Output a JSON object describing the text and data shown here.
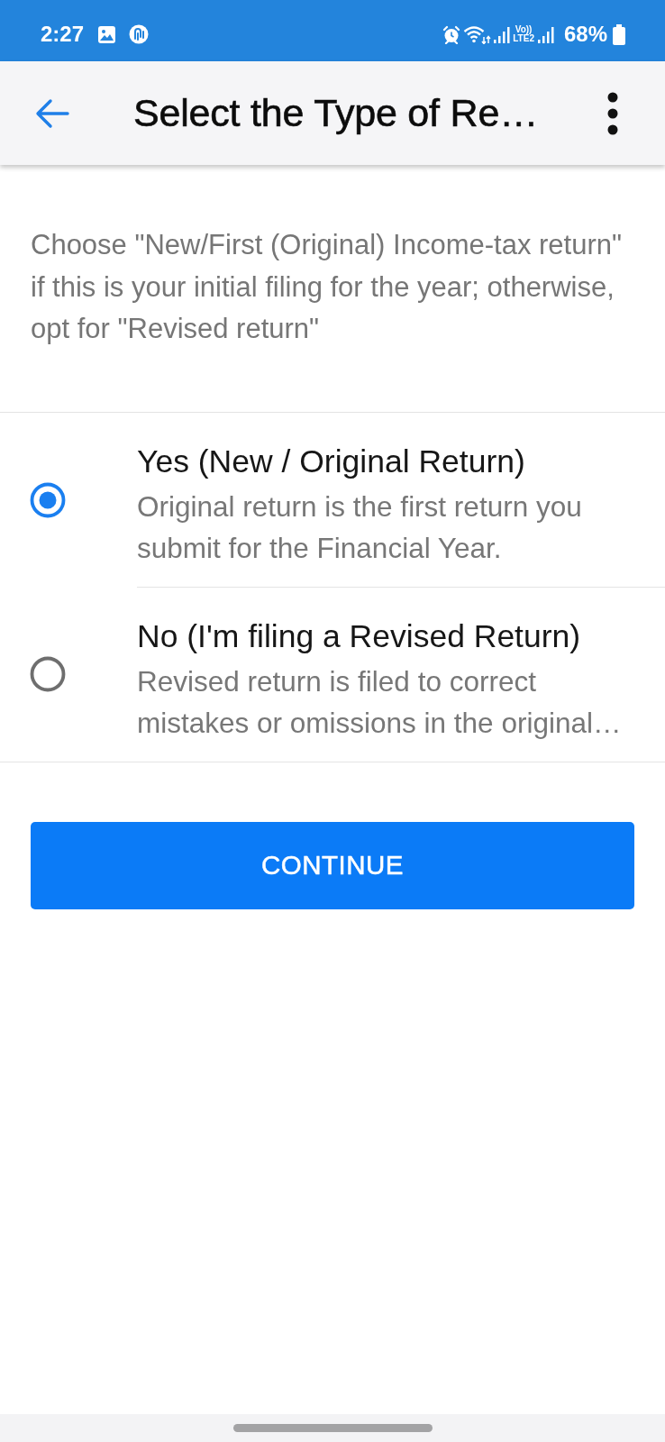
{
  "status_bar": {
    "time": "2:27",
    "network_top": "Vo))",
    "network_bottom": "LTE2",
    "battery": "68%"
  },
  "app_bar": {
    "title": "Select the Type of Re…"
  },
  "description": "Choose \"New/First (Original) Income-tax return\" if this is your initial filing for the year; otherwise, opt for \"Revised return\"",
  "options": [
    {
      "title": "Yes (New / Original Return)",
      "description": "Original return is the first return you submit for the Financial Year.",
      "selected": true
    },
    {
      "title": "No (I'm filing a Revised Return)",
      "description": "Revised return is filed to correct mistakes or omissions in the original…",
      "selected": false
    }
  ],
  "continue_button": {
    "label": "CONTINUE"
  }
}
